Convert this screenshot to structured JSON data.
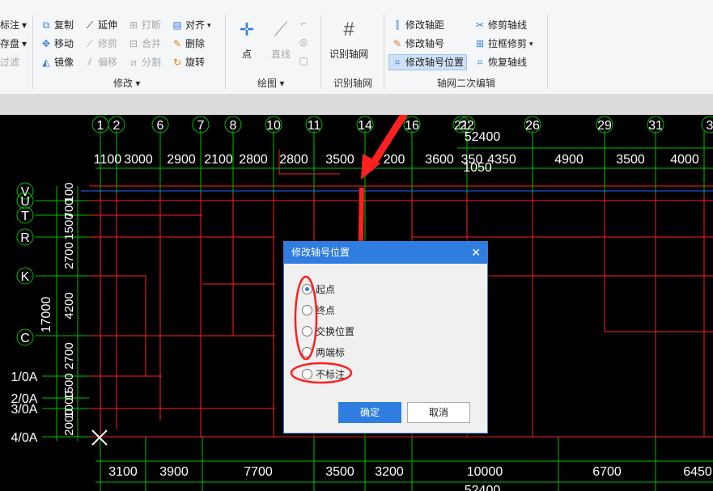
{
  "ribbon": {
    "col0": [
      "标注",
      "存盘",
      "过滤"
    ],
    "modify": {
      "col1": [
        "复制",
        "移动",
        "镜像"
      ],
      "col2": [
        "延伸",
        "修剪",
        "偏移"
      ],
      "col3": [
        "打断",
        "合并",
        "分割"
      ],
      "col4": [
        "对齐",
        "删除",
        "旋转"
      ],
      "label": "修改"
    },
    "draw": {
      "point": "点",
      "line": "直线",
      "label": "绘图"
    },
    "recognize": {
      "button": "识别轴网",
      "label": "识别轴网"
    },
    "edit2": {
      "col1": [
        "修改轴距",
        "修改轴号",
        "修改轴号位置"
      ],
      "col2": [
        "修剪轴线",
        "拉框修剪",
        "恢复轴线"
      ],
      "label": "轴网二次编辑"
    }
  },
  "cad": {
    "top_axis_numbers": [
      "1",
      "2",
      "6",
      "7",
      "8",
      "10",
      "11",
      "14",
      "16",
      "21",
      "22",
      "26",
      "29",
      "31",
      "3"
    ],
    "top_total": "52400",
    "top_spacings": [
      "1100",
      "3000",
      "2900",
      "2100",
      "2800",
      "2800",
      "3500",
      "200",
      "3600",
      "350",
      "4350",
      "4900",
      "3500",
      "4000"
    ],
    "extra_spacing": "1050",
    "left_axis_letters": [
      "V",
      "U",
      "T",
      "R",
      "K",
      "C",
      "1/0A",
      "2/0A",
      "3/0A",
      "4/0A"
    ],
    "left_dims": [
      "100",
      "700",
      "1500",
      "2700",
      "4200",
      "2700",
      "1500",
      "1000",
      "2000"
    ],
    "left_total": "17000",
    "bottom_spacings": [
      "3100",
      "3900",
      "7700",
      "3500",
      "3200",
      "10000",
      "6700",
      "6450"
    ],
    "bottom_total": "52400"
  },
  "dialog": {
    "title": "修改轴号位置",
    "close": "✕",
    "options": [
      "起点",
      "终点",
      "交换位置",
      "两端标",
      "不标注"
    ],
    "selected": "起点",
    "ok": "确定",
    "cancel": "取消"
  },
  "colors": {
    "titlebar": "#2f7de1",
    "annotation": "#ff2020",
    "axis_green": "#00c000",
    "axis_red": "#ff2020"
  }
}
